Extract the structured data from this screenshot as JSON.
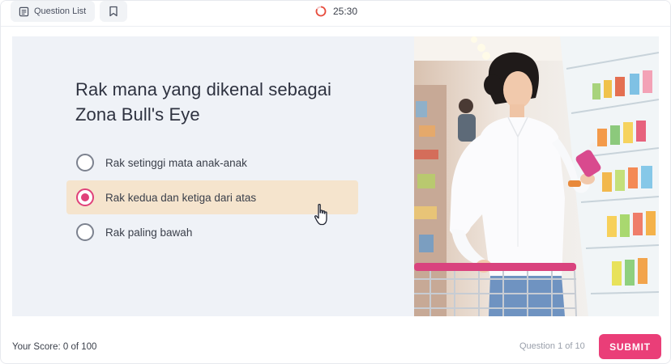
{
  "topbar": {
    "question_list_label": "Question List",
    "bookmark_icon": "bookmark-icon",
    "timer": "25:30"
  },
  "quiz": {
    "question": "Rak mana yang dikenal sebagai Zona Bull's Eye",
    "options": [
      {
        "label": "Rak setinggi mata anak-anak",
        "selected": false
      },
      {
        "label": "Rak kedua dan ketiga dari atas",
        "selected": true
      },
      {
        "label": "Rak paling bawah",
        "selected": false
      }
    ]
  },
  "footer": {
    "score": "Your Score: 0 of 100",
    "question_count": "Question 1 of 10",
    "submit_label": "SUBMIT"
  },
  "colors": {
    "accent": "#ea3e78",
    "selected_bg": "#f5e4cd",
    "card_bg": "#eff2f7"
  }
}
